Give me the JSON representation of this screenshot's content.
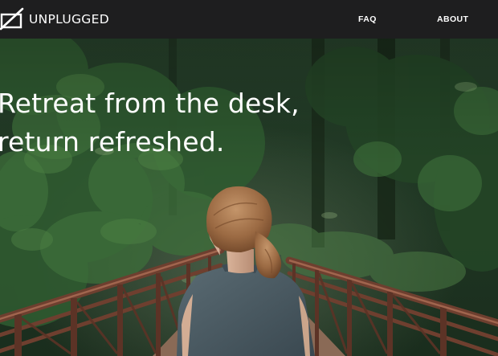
{
  "header": {
    "brand": "UNPLUGGED",
    "logo_icon": "crossed-rectangle-logo-icon",
    "nav": [
      {
        "label": "FAQ"
      },
      {
        "label": "ABOUT"
      }
    ]
  },
  "hero": {
    "heading_lines": [
      "Retreat from the desk,",
      "return refreshed."
    ],
    "photo": "woman-on-wooden-bridge-in-forest"
  },
  "colors": {
    "header_bg": "#1e1e1f",
    "text": "#ffffff",
    "forest_dark": "#1a2b1c",
    "bridge_rail": "#7a4a38",
    "shirt": "#4a5a62",
    "hair": "#9a6a44"
  }
}
